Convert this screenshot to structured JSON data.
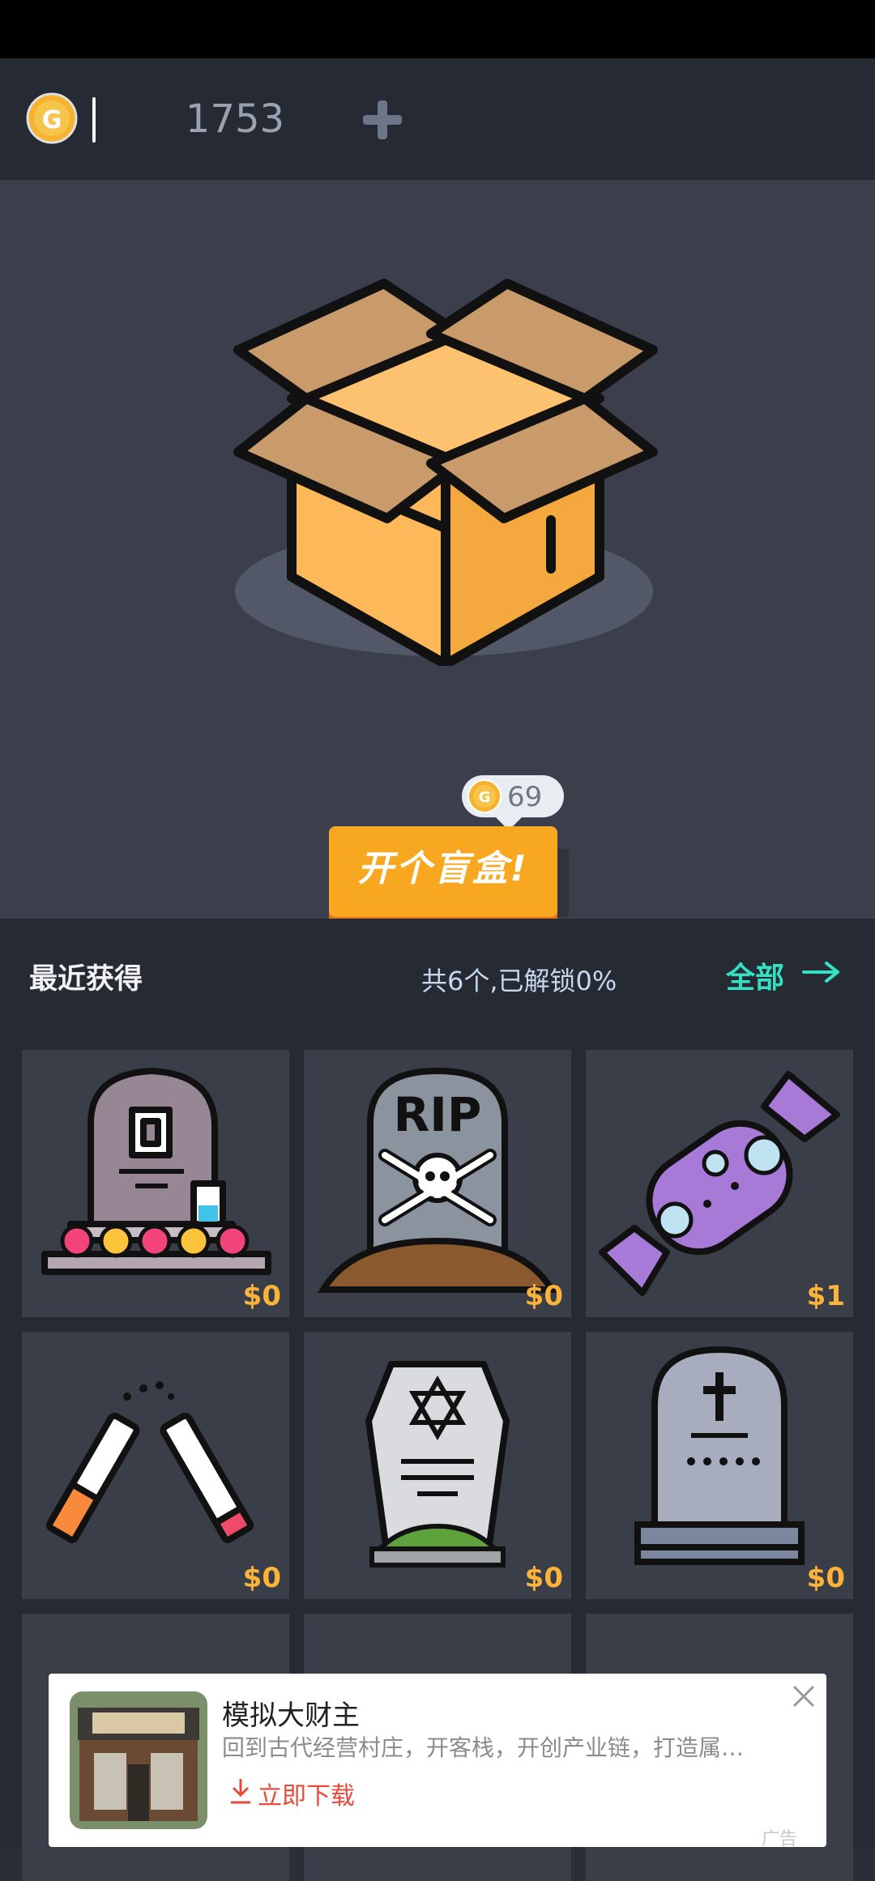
{
  "header": {
    "coin_symbol": "G",
    "coin_balance": "1753"
  },
  "mystery_box": {
    "price": "69",
    "open_button_label": "开个盲盒!"
  },
  "recent": {
    "title": "最近获得",
    "unlock_status": "共6个,已解锁0%",
    "all_link": "全部"
  },
  "items": [
    {
      "icon": "memorial-grave-icon",
      "price": "$0"
    },
    {
      "icon": "rip-tombstone-icon",
      "price": "$0"
    },
    {
      "icon": "candy-icon",
      "price": "$1"
    },
    {
      "icon": "broken-cigarette-icon",
      "price": "$0"
    },
    {
      "icon": "star-of-david-tombstone-icon",
      "price": "$0"
    },
    {
      "icon": "cross-tombstone-icon",
      "price": "$0"
    }
  ],
  "ad": {
    "title": "模拟大财主",
    "description": "回到古代经营村庄，开客栈，开创产业链，打造属…",
    "download_label": "立即下载",
    "badge": "广告"
  },
  "colors": {
    "accent_orange": "#f8a720",
    "price_gold": "#fbb33a",
    "link_teal": "#36e0c2"
  }
}
